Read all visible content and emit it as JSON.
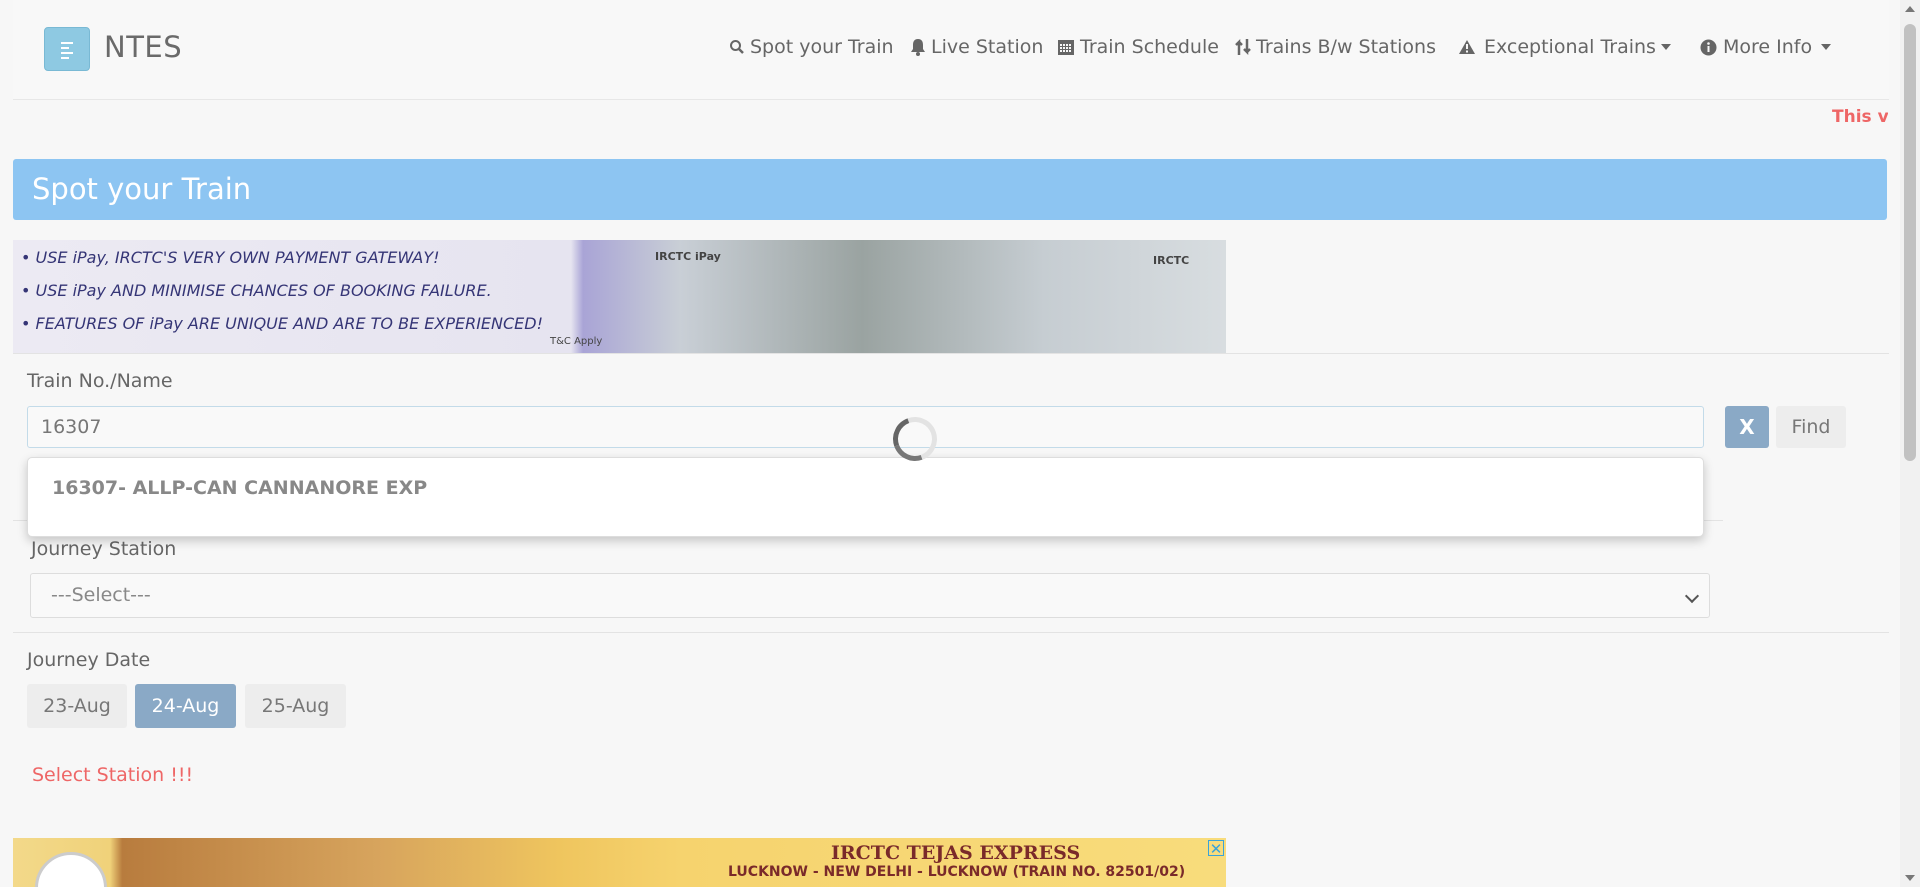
{
  "app": {
    "brand": "NTES"
  },
  "nav": {
    "items": [
      {
        "label": "Spot your Train",
        "icon": "search-icon"
      },
      {
        "label": "Live Station",
        "icon": "bell-icon"
      },
      {
        "label": "Train Schedule",
        "icon": "calendar-icon"
      },
      {
        "label": "Trains B/w Stations",
        "icon": "swap-vertical-icon"
      },
      {
        "label": "Exceptional Trains",
        "icon": "warning-icon",
        "dropdown": true
      },
      {
        "label": "More Info",
        "icon": "info-icon",
        "dropdown": true
      }
    ]
  },
  "marquee": {
    "text": "This ve"
  },
  "page": {
    "title": "Spot your Train"
  },
  "ad_top": {
    "lines": [
      "• USE iPay, IRCTC'S VERY OWN PAYMENT GATEWAY!",
      "• USE iPay AND MINIMISE CHANCES OF BOOKING FAILURE.",
      "• FEATURES OF iPay ARE UNIQUE AND ARE TO BE EXPERIENCED!"
    ],
    "tc": "T&C Apply",
    "logo_a": "IRCTC iPay",
    "logo_b": "IRCTC"
  },
  "train": {
    "label": "Train No./Name",
    "value": "16307",
    "clear_label": "X",
    "find_label": "Find",
    "suggestions": [
      "16307- ALLP-CAN CANNANORE EXP"
    ]
  },
  "station": {
    "label": "Journey Station",
    "selected": "---Select---"
  },
  "date": {
    "label": "Journey Date",
    "options": [
      "23-Aug",
      "24-Aug",
      "25-Aug"
    ],
    "selected": "24-Aug"
  },
  "error": {
    "text": "Select Station !!!"
  },
  "ad_bottom": {
    "title": "IRCTC TEJAS EXPRESS",
    "subtitle": "LUCKNOW - NEW DELHI - LUCKNOW (TRAIN NO. 82501/02)",
    "close": "✕"
  },
  "colors": {
    "accent": "#8dc5f2",
    "primary_button": "#8aa9c6",
    "error": "#e66666"
  }
}
